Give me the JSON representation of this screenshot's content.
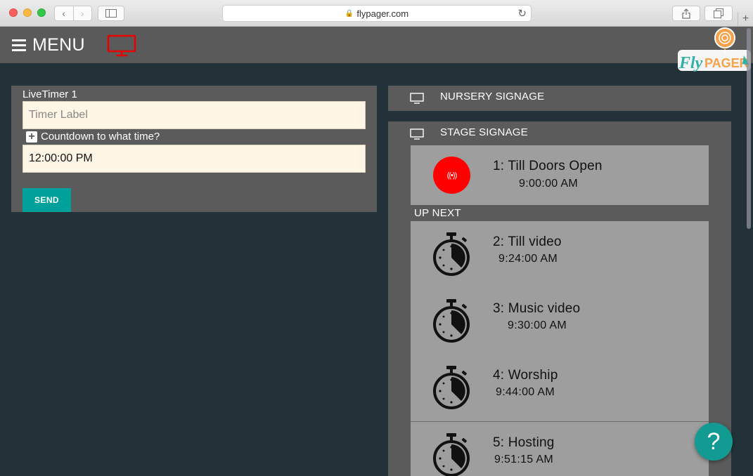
{
  "browser": {
    "url": "flypager.com",
    "lock_glyph": "🔒",
    "reload_glyph": "↻",
    "back_glyph": "‹",
    "forward_glyph": "›",
    "newtab_glyph": "+"
  },
  "header": {
    "menu_label": "MENU",
    "logo_text": "FlyPAGER"
  },
  "live_timer": {
    "title": "LiveTimer 1",
    "label_placeholder": "Timer Label",
    "plus_glyph": "+",
    "countdown_label": "Countdown to what time?",
    "time_value": "12:00:00 PM",
    "send_label": "SEND"
  },
  "signage": {
    "nursery_label": "NURSERY SIGNAGE",
    "stage_label": "STAGE SIGNAGE",
    "current": {
      "title": "1: Till Doors Open",
      "time": "9:00:00 AM",
      "live_glyph": "((•))"
    },
    "up_next_label": "UP NEXT",
    "next_items": [
      {
        "title": "2: Till video",
        "time": "9:24:00 AM"
      },
      {
        "title": "3: Music video",
        "time": "9:30:00 AM"
      },
      {
        "title": "4: Worship",
        "time": "9:44:00 AM"
      },
      {
        "title": "5: Hosting",
        "time": "9:51:15 AM"
      }
    ]
  },
  "help": {
    "glyph": "?"
  },
  "colors": {
    "accent_teal": "#00a19a",
    "live_red": "#ff0000",
    "background": "#233239",
    "panel": "#5b5b5b"
  }
}
